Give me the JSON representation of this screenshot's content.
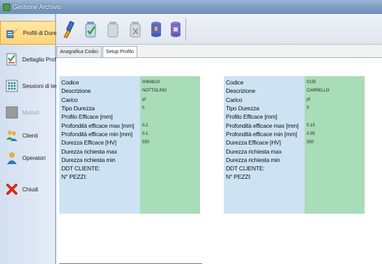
{
  "window": {
    "title": "Gestione Archivio"
  },
  "sidebar": {
    "items": [
      {
        "label": "Profili di Durezza",
        "icon": "profile-brush-icon",
        "active": true
      },
      {
        "label": "Dettaglio Profilo",
        "icon": "checklist-icon",
        "active": false
      },
      {
        "label": "Sessioni di test",
        "icon": "grid-dots-icon",
        "active": false
      },
      {
        "label": "Metodi",
        "icon": "gray-box-icon",
        "active": false,
        "disabled": true
      },
      {
        "label": "Clienti",
        "icon": "users-icon",
        "active": false
      },
      {
        "label": "Operatori",
        "icon": "user-icon",
        "active": false
      },
      {
        "label": "Chiudi",
        "icon": "close-x-icon",
        "active": false
      }
    ]
  },
  "toolbar": {
    "buttons": [
      {
        "icon": "brush-icon"
      },
      {
        "icon": "jar-check-icon"
      },
      {
        "icon": "jar-gray-icon"
      },
      {
        "icon": "jar-x-icon"
      },
      {
        "icon": "db-import-icon"
      },
      {
        "icon": "db-export-icon"
      }
    ]
  },
  "tabs": [
    {
      "label": "Anagrafica Codici",
      "active": false
    },
    {
      "label": "Setup Profilo",
      "active": true
    }
  ],
  "fields_labels": [
    "Codice",
    "Descrizione",
    "Carico",
    "Tipo Durezza",
    "Profilo Efficace [mm]",
    "Profondità efficace max [mm]",
    "Profondità efficace min [mm]",
    "Durezza Efficace [HV]",
    "Durezza richiesta max",
    "Durezza richiesta min",
    "DDT CLIENTE:",
    "N° PEZZI:"
  ],
  "left_values": [
    "00636/10",
    "NOTTOLINO",
    "pf",
    "0",
    "",
    "0.2",
    "0.1",
    "550",
    "",
    "",
    "",
    ""
  ],
  "right_values": [
    "0135",
    "CARRELLO",
    "pf",
    "0",
    "",
    "0.15",
    "0.05",
    "550",
    "",
    "",
    "",
    ""
  ],
  "colors": {
    "label_bg": "#cde3f3",
    "value_bg": "#a9dcb8",
    "active_nav": "#ffd477"
  }
}
